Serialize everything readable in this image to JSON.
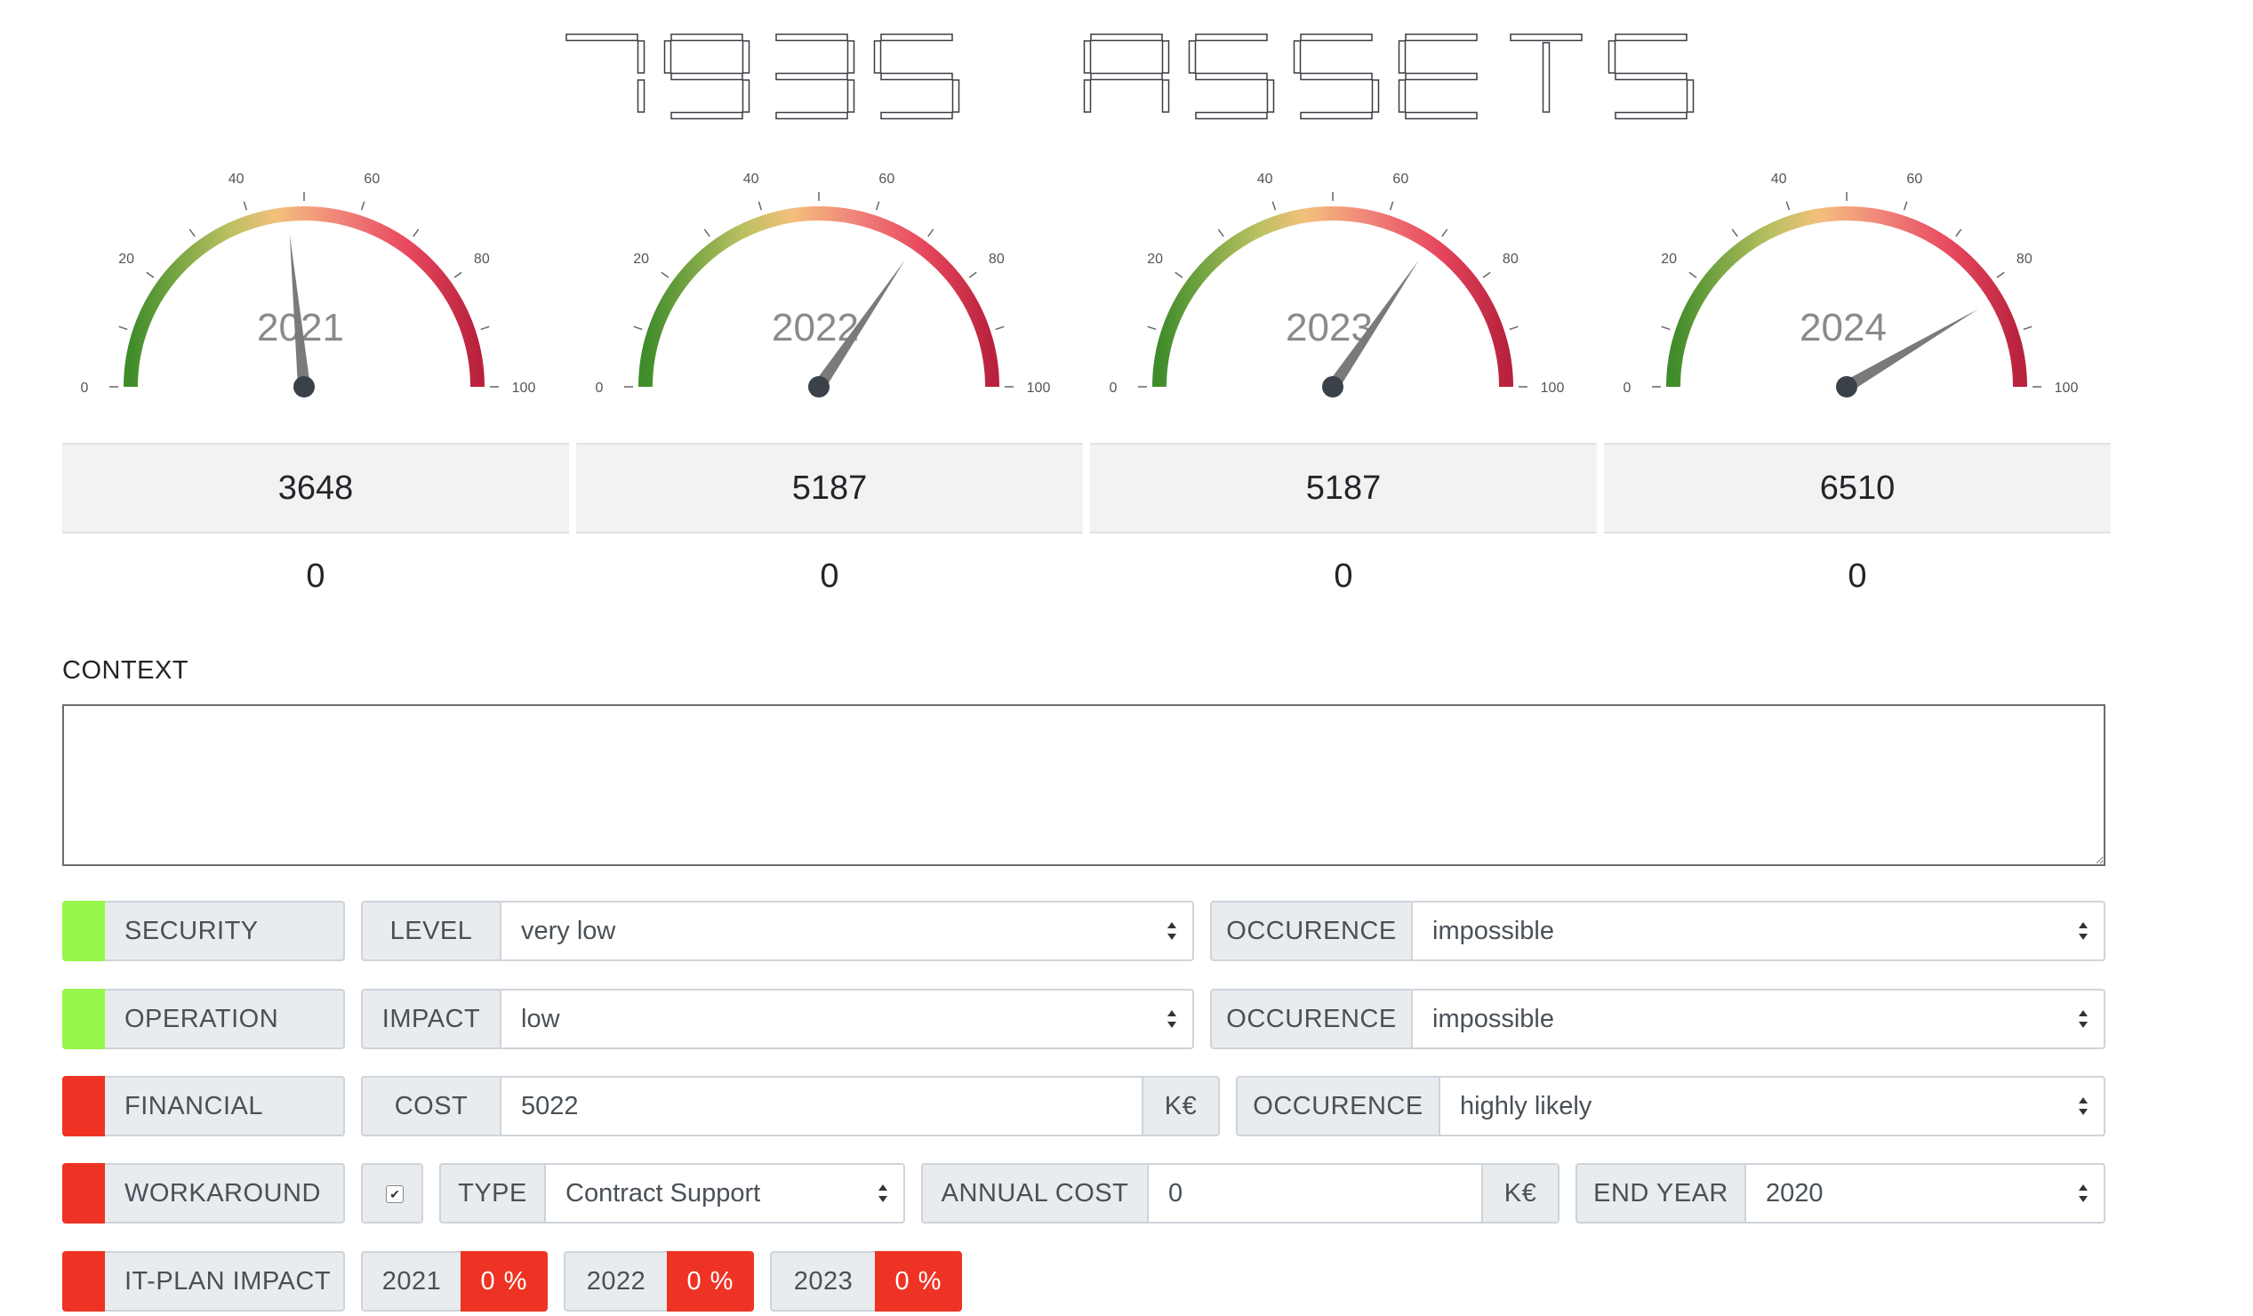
{
  "header": {
    "title": "7935 ASSETS"
  },
  "gauges": [
    {
      "year": "2021",
      "needle_value": 47,
      "total": "3648",
      "count": "0"
    },
    {
      "year": "2022",
      "needle_value": 69,
      "total": "5187",
      "count": "0"
    },
    {
      "year": "2023",
      "needle_value": 69,
      "total": "5187",
      "count": "0"
    },
    {
      "year": "2024",
      "needle_value": 83,
      "total": "6510",
      "count": "0"
    }
  ],
  "gauge_scale": {
    "min": 0,
    "max": 100,
    "ticks": [
      "0",
      "20",
      "40",
      "60",
      "80",
      "100"
    ]
  },
  "context": {
    "label": "CONTEXT",
    "value": ""
  },
  "colors": {
    "ok": "#98f54c",
    "alert": "#ee3324"
  },
  "rows": {
    "security": {
      "label": "SECURITY",
      "status": "ok",
      "level_label": "LEVEL",
      "level_value": "very low",
      "occ_label": "OCCURENCE",
      "occ_value": "impossible"
    },
    "operation": {
      "label": "OPERATION",
      "status": "ok",
      "impact_label": "IMPACT",
      "impact_value": "low",
      "occ_label": "OCCURENCE",
      "occ_value": "impossible"
    },
    "financial": {
      "label": "FINANCIAL",
      "status": "alert",
      "cost_label": "COST",
      "cost_value": "5022",
      "unit": "K€",
      "occ_label": "OCCURENCE",
      "occ_value": "highly likely"
    },
    "workaround": {
      "label": "WORKAROUND",
      "status": "alert",
      "checked": true,
      "type_label": "TYPE",
      "type_value": "Contract Support",
      "annual_label": "ANNUAL COST",
      "annual_value": "0",
      "unit": "K€",
      "end_label": "END YEAR",
      "end_value": "2020"
    },
    "itplan": {
      "label": "IT-PLAN IMPACT",
      "status": "alert",
      "years": [
        {
          "year": "2021",
          "pct": "0 %"
        },
        {
          "year": "2022",
          "pct": "0 %"
        },
        {
          "year": "2023",
          "pct": "0 %"
        }
      ]
    }
  }
}
